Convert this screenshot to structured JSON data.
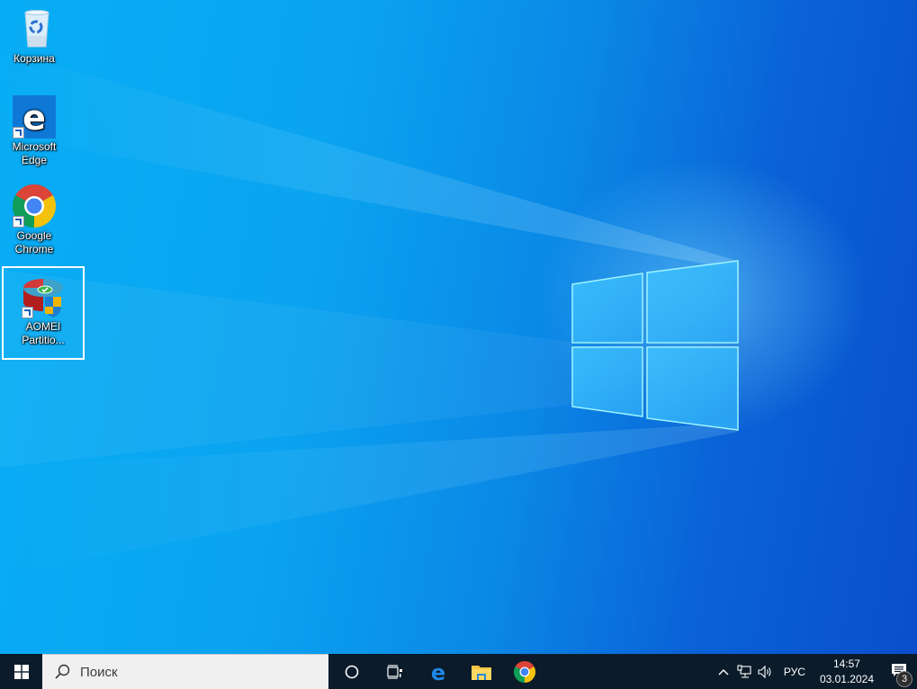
{
  "desktop": {
    "icons": [
      {
        "id": "recycle-bin",
        "label": "Корзина",
        "icon": "recycle-bin-icon",
        "shortcut": false,
        "selected": false
      },
      {
        "id": "microsoft-edge",
        "label": "Microsoft Edge",
        "icon": "edge-icon",
        "shortcut": true,
        "selected": false
      },
      {
        "id": "google-chrome",
        "label": "Google Chrome",
        "icon": "chrome-icon",
        "shortcut": true,
        "selected": false
      },
      {
        "id": "aomei-partition",
        "label": "AOMEI Partitio...",
        "icon": "aomei-partition-icon",
        "shortcut": true,
        "selected": true
      }
    ],
    "labels": {
      "recycle_bin": "Корзина",
      "edge_line1": "Microsoft",
      "edge_line2": "Edge",
      "chrome_line1": "Google",
      "chrome_line2": "Chrome",
      "aomei_line1": "AOMEI",
      "aomei_line2": "Partitio..."
    },
    "colors": {
      "wallpaper_left": "#08aef5",
      "wallpaper_right": "#0a4fcc",
      "logo_glow": "#7fe8ff"
    }
  },
  "taskbar": {
    "start_icon": "windows-logo-icon",
    "search": {
      "placeholder": "Поиск",
      "icon": "search-icon"
    },
    "buttons": [
      {
        "name": "cortana",
        "icon": "cortana-circle-icon"
      },
      {
        "name": "task-view",
        "icon": "task-view-icon"
      },
      {
        "name": "edge",
        "icon": "edge-icon"
      },
      {
        "name": "file-explorer",
        "icon": "folder-icon"
      },
      {
        "name": "chrome",
        "icon": "chrome-icon"
      }
    ],
    "tray": {
      "show_hidden_icon": "chevron-up-icon",
      "network_icon": "network-icon",
      "volume_icon": "volume-icon",
      "language": "РУС",
      "time": "14:57",
      "date": "03.01.2024",
      "notifications_icon": "action-center-icon",
      "notifications_count": "3"
    },
    "colors": {
      "background": "#0b1b2a",
      "search_bg": "#f0f0f0"
    }
  }
}
